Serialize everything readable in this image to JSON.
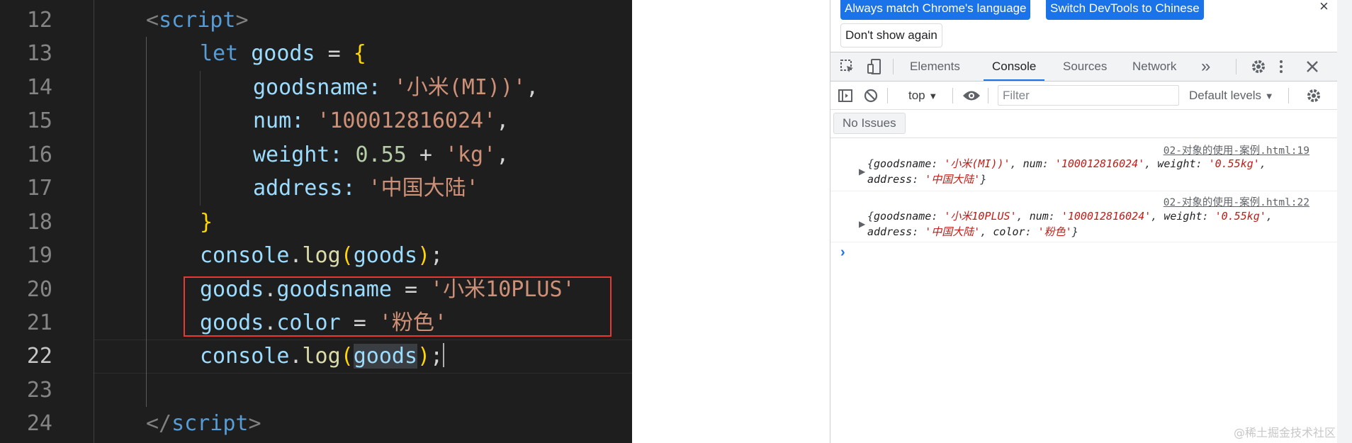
{
  "editor": {
    "line_numbers": [
      "12",
      "13",
      "14",
      "15",
      "16",
      "17",
      "18",
      "19",
      "20",
      "21",
      "22",
      "23",
      "24"
    ],
    "code": {
      "l12": {
        "open": "<",
        "tag": "script",
        "close": ">"
      },
      "l13": {
        "kw": "let",
        "var": "goods",
        "eq": "=",
        "brace": "{"
      },
      "l14": {
        "key": "goodsname",
        "colon": ":",
        "str": "'小米(MI))'",
        "comma": ","
      },
      "l15": {
        "key": "num",
        "colon": ":",
        "str": "'100012816024'",
        "comma": ","
      },
      "l16": {
        "key": "weight",
        "colon": ":",
        "num": "0.55",
        "plus": "+",
        "str": "'kg'",
        "comma": ","
      },
      "l17": {
        "key": "address",
        "colon": ":",
        "str": "'中国大陆'"
      },
      "l18": {
        "brace": "}"
      },
      "l19": {
        "obj": "console",
        "dot": ".",
        "fn": "log",
        "popen": "(",
        "arg": "goods",
        "pclose": ")",
        "semi": ";"
      },
      "l20": {
        "obj": "goods",
        "dot": ".",
        "prop": "goodsname",
        "eq": "=",
        "str": "'小米10PLUS'"
      },
      "l21": {
        "obj": "goods",
        "dot": ".",
        "prop": "color",
        "eq": "=",
        "str": "'粉色'"
      },
      "l22": {
        "obj": "console",
        "dot": ".",
        "fn": "log",
        "popen": "(",
        "arg": "goods",
        "pclose": ")",
        "semi": ";"
      },
      "l24": {
        "open": "</",
        "tag": "script",
        "close": ">"
      }
    }
  },
  "devtools": {
    "banner_buttons": {
      "match_language": "Always match Chrome's language",
      "switch_chinese": "Switch DevTools to Chinese",
      "dont_show": "Don't show again"
    },
    "close_glyph": "×",
    "tabs": [
      "Elements",
      "Console",
      "Sources",
      "Network"
    ],
    "more_tabs_glyph": "»",
    "filter": {
      "context": "top",
      "placeholder": "Filter",
      "levels": "Default levels"
    },
    "issues_label": "No Issues",
    "messages": [
      {
        "source": "02-对象的使用-案例.html:19",
        "row1": [
          {
            "t": "{"
          },
          {
            "t": "goodsname",
            "c": "k"
          },
          {
            "t": ": "
          },
          {
            "t": "'小米(MI))'",
            "c": "v"
          },
          {
            "t": ", "
          },
          {
            "t": "num",
            "c": "k"
          },
          {
            "t": ": "
          },
          {
            "t": "'100012816024'",
            "c": "v"
          },
          {
            "t": ", "
          },
          {
            "t": "weight",
            "c": "k"
          },
          {
            "t": ": "
          },
          {
            "t": "'0.55kg'",
            "c": "v"
          },
          {
            "t": ","
          }
        ],
        "row2": [
          {
            "t": "address",
            "c": "k"
          },
          {
            "t": ": "
          },
          {
            "t": "'中国大陆'",
            "c": "v"
          },
          {
            "t": "}"
          }
        ]
      },
      {
        "source": "02-对象的使用-案例.html:22",
        "row1": [
          {
            "t": "{"
          },
          {
            "t": "goodsname",
            "c": "k"
          },
          {
            "t": ": "
          },
          {
            "t": "'小米10PLUS'",
            "c": "v"
          },
          {
            "t": ", "
          },
          {
            "t": "num",
            "c": "k"
          },
          {
            "t": ": "
          },
          {
            "t": "'100012816024'",
            "c": "v"
          },
          {
            "t": ", "
          },
          {
            "t": "weight",
            "c": "k"
          },
          {
            "t": ": "
          },
          {
            "t": "'0.55kg'",
            "c": "v"
          },
          {
            "t": ","
          }
        ],
        "row2": [
          {
            "t": "address",
            "c": "k"
          },
          {
            "t": ": "
          },
          {
            "t": "'中国大陆'",
            "c": "v"
          },
          {
            "t": ", "
          },
          {
            "t": "color",
            "c": "k"
          },
          {
            "t": ": "
          },
          {
            "t": "'粉色'",
            "c": "v"
          },
          {
            "t": "}"
          }
        ]
      }
    ],
    "prompt_glyph": "›"
  },
  "watermark": "@稀土掘金技术社区",
  "colors": {
    "editor_bg": "#1e1e1e",
    "highlight_box": "#e53935",
    "devtools_accent": "#1a73e8",
    "console_string": "#c41a16"
  }
}
